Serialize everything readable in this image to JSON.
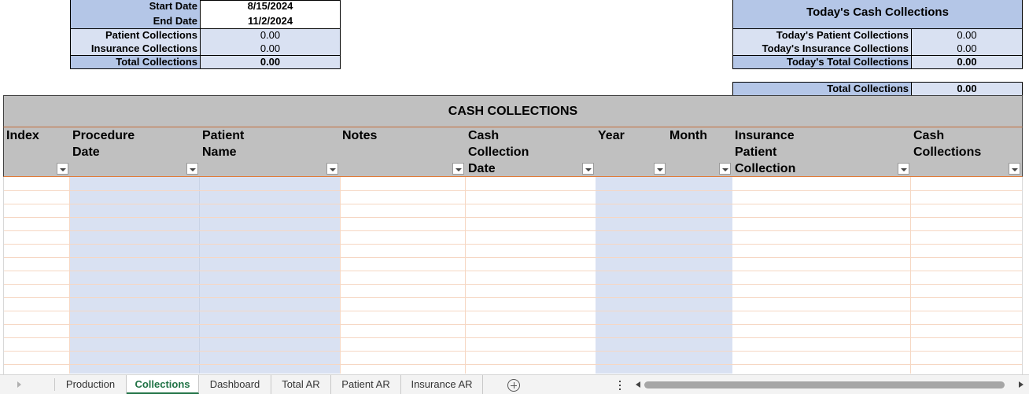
{
  "summary_left": {
    "start_label": "Start Date",
    "start_value": "8/15/2024",
    "end_label": "End Date",
    "end_value": "11/2/2024",
    "patient_label": "Patient Collections",
    "patient_value": "0.00",
    "insurance_label": "Insurance Collections",
    "insurance_value": "0.00",
    "total_label": "Total Collections",
    "total_value": "0.00"
  },
  "summary_right": {
    "title": "Today's Cash Collections",
    "patient_label": "Today's Patient Collections",
    "patient_value": "0.00",
    "insurance_label": "Today's Insurance Collections",
    "insurance_value": "0.00",
    "total_label": "Today's Total Collections",
    "total_value": "0.00",
    "grand_label": "Total Collections",
    "grand_value": "0.00"
  },
  "table": {
    "title": "CASH COLLECTIONS",
    "columns": [
      "Index",
      "Procedure\nDate",
      "Patient\nName",
      "Notes",
      "Cash\nCollection\nDate",
      "Year",
      "Month",
      "Insurance\nPatient\nCollection",
      "Cash\nCollections"
    ]
  },
  "sheet_tabs": [
    "Production",
    "Collections",
    "Dashboard",
    "Total AR",
    "Patient AR",
    "Insurance AR"
  ],
  "active_tab": "Collections",
  "add_sheet_icon": "plus-circle-icon",
  "colors": {
    "header_blue": "#b4c6e7",
    "value_blue": "#d9e1f2",
    "header_gray": "#c0c0c0",
    "accent_green": "#217346",
    "header_border_orange": "#e07b39"
  }
}
